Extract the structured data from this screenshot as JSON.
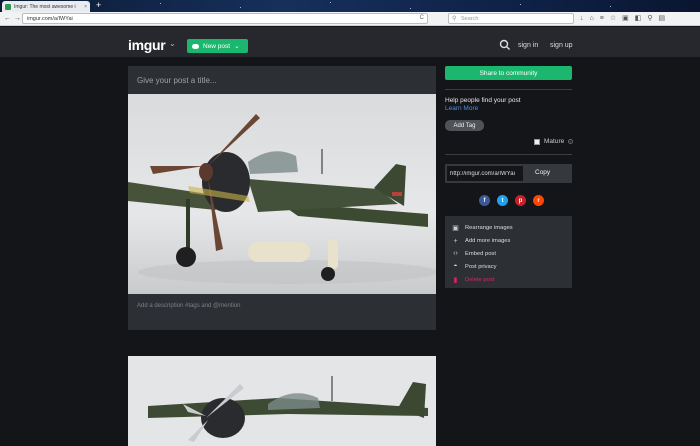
{
  "browser": {
    "tab_title": "Imgur: The most awesome i",
    "tab_close": "×",
    "new_tab": "+",
    "back": "←",
    "forward": "→",
    "url": "imgur.com/a/IWYai",
    "reload": "C",
    "search_placeholder": "Search",
    "toolbar_icons": [
      "↓",
      "⌂",
      "≡",
      "☆",
      "▣",
      "◧",
      "⚲",
      "▤"
    ]
  },
  "header": {
    "logo": "imgur",
    "logo_chevron": "⌄",
    "new_post": "New post",
    "new_post_chevron": "⌄",
    "sign_in": "sign in",
    "sign_up": "sign up"
  },
  "post": {
    "title_placeholder": "Give your post a title...",
    "description_placeholder": "Add a description #tags and @mention"
  },
  "sidebar": {
    "share_button": "Share to community",
    "help_text": "Help people find your post",
    "learn_more": "Learn More",
    "add_tag": "Add Tag",
    "mature_label": "Mature",
    "mature_help": "?",
    "share_link": "http://imgur.com/a/IWYai",
    "copy_button": "Copy",
    "social": [
      {
        "glyph": "f",
        "color": "#3b5998"
      },
      {
        "glyph": "t",
        "color": "#1da1f2"
      },
      {
        "glyph": "p",
        "color": "#cb2027"
      },
      {
        "glyph": "r",
        "color": "#ff4500"
      }
    ],
    "options": [
      {
        "icon": "▣",
        "label": "Rearrange images"
      },
      {
        "icon": "+",
        "label": "Add more images"
      },
      {
        "icon": "‹›",
        "label": "Embed post"
      },
      {
        "icon": "◓",
        "label": "Post privacy"
      },
      {
        "icon": "▮",
        "label": "Delete post"
      }
    ]
  },
  "colors": {
    "accent_green": "#1bb76e",
    "background": "#141518",
    "card": "#2c2f34",
    "link_blue": "#4e8fdc",
    "danger": "#e0245e"
  }
}
